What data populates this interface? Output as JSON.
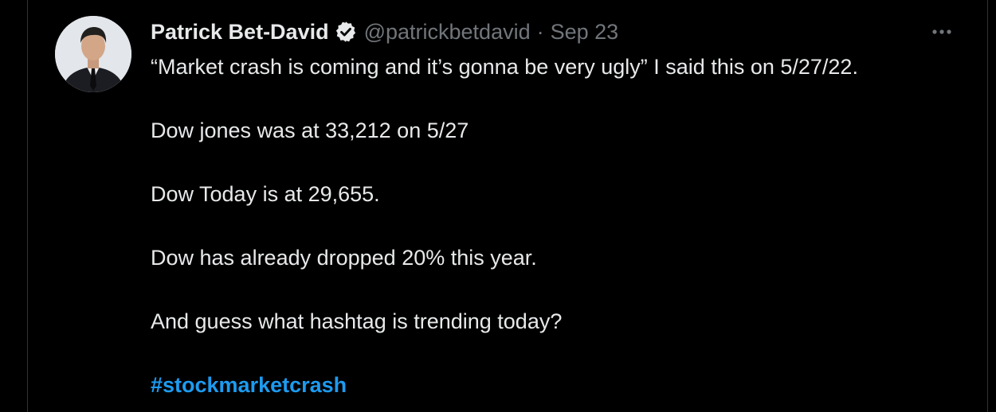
{
  "author": {
    "name": "Patrick Bet-David",
    "handle": "@patrickbetdavid",
    "separator": "·",
    "date": "Sep 23",
    "verified": true
  },
  "icons": {
    "avatar": "profile-photo",
    "verified": "verified-badge-icon",
    "more": "more-options-icon"
  },
  "tweet": {
    "lines": [
      "“Market crash is coming and it’s gonna be very ugly” I said this on 5/27/22.",
      "Dow jones was at 33,212 on 5/27",
      "Dow Today is at 29,655.",
      "Dow has already dropped 20% this year.",
      "And guess what hashtag is trending today?"
    ],
    "hashtag": "#stockmarketcrash"
  },
  "colors": {
    "background": "#000000",
    "text": "#e7e9ea",
    "muted": "#71767b",
    "link": "#1d9bf0"
  }
}
